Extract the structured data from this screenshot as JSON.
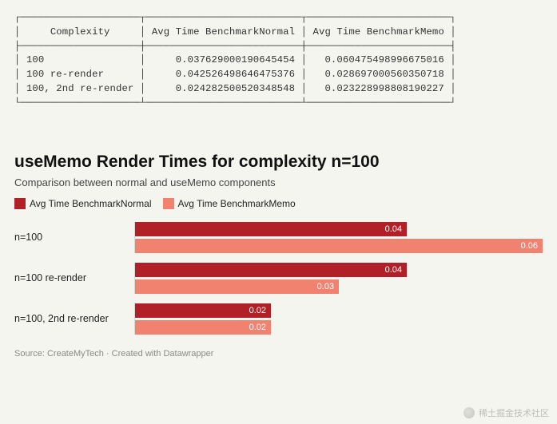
{
  "table": {
    "headers": [
      "Complexity",
      "Avg Time BenchmarkNormal",
      "Avg Time BenchmarkMemo"
    ],
    "rows": [
      {
        "complexity": "100",
        "normal": "0.037629000190645454",
        "memo": "0.060475498996675016"
      },
      {
        "complexity": "100 re-render",
        "normal": "0.042526498646475376",
        "memo": "0.028697000560350718"
      },
      {
        "complexity": "100, 2nd re-render",
        "normal": "0.024282500520348548",
        "memo": "0.023228998808190227"
      }
    ]
  },
  "chart_data": {
    "type": "bar",
    "title": "useMemo Render Times for complexity n=100",
    "subtitle": "Comparison between normal and useMemo components",
    "xlabel": "",
    "ylabel": "",
    "ylim": [
      0,
      0.06
    ],
    "legend_position": "top",
    "categories": [
      "n=100",
      "n=100 re-render",
      "n=100, 2nd re-render"
    ],
    "series": [
      {
        "name": "Avg Time BenchmarkNormal",
        "color": "#b22027",
        "values": [
          0.04,
          0.04,
          0.02
        ]
      },
      {
        "name": "Avg Time BenchmarkMemo",
        "color": "#f1826f",
        "values": [
          0.06,
          0.03,
          0.02
        ]
      }
    ],
    "source": "Source: CreateMyTech · Created with Datawrapper"
  },
  "watermark": "稀土掘金技术社区"
}
